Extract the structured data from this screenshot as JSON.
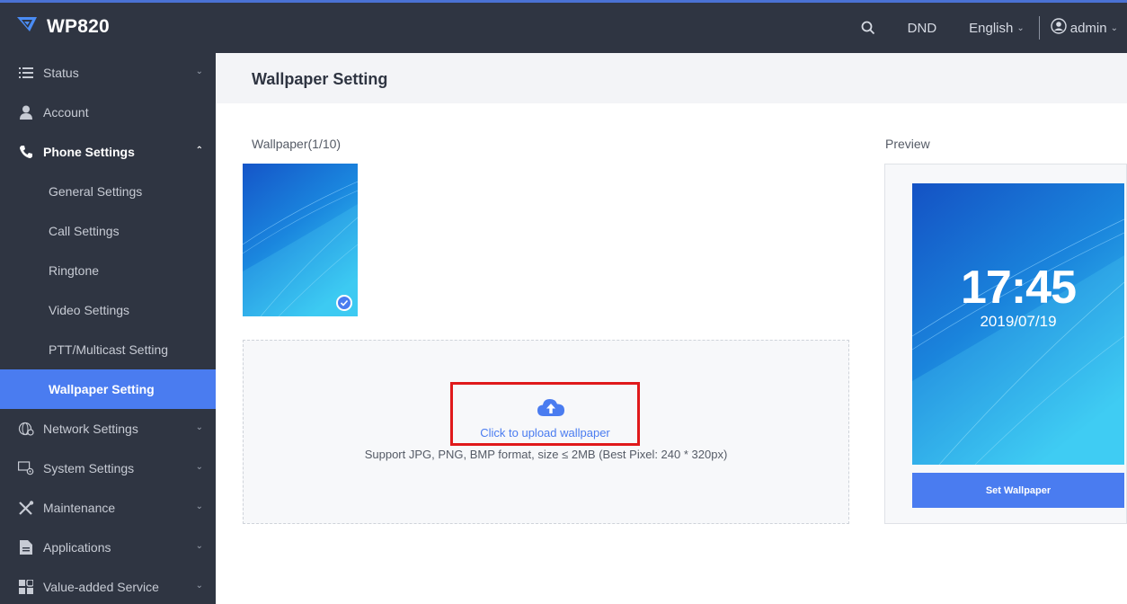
{
  "app": {
    "name": "WP820"
  },
  "topbar": {
    "dnd": "DND",
    "language": "English",
    "user": "admin"
  },
  "sidebar": {
    "items": [
      {
        "label": "Status",
        "icon": "list-icon"
      },
      {
        "label": "Account",
        "icon": "user-icon"
      },
      {
        "label": "Phone Settings",
        "icon": "phone-icon"
      },
      {
        "label": "General Settings"
      },
      {
        "label": "Call Settings"
      },
      {
        "label": "Ringtone"
      },
      {
        "label": "Video Settings"
      },
      {
        "label": "PTT/Multicast Setting"
      },
      {
        "label": "Wallpaper Setting"
      },
      {
        "label": "Network Settings",
        "icon": "network-globe-icon"
      },
      {
        "label": "System Settings",
        "icon": "system-gear-icon"
      },
      {
        "label": "Maintenance",
        "icon": "tools-icon"
      },
      {
        "label": "Applications",
        "icon": "document-icon"
      },
      {
        "label": "Value-added Service",
        "icon": "grid-icon"
      }
    ]
  },
  "page": {
    "title": "Wallpaper Setting",
    "wallpaper_label": "Wallpaper(1/10)",
    "preview_label": "Preview",
    "upload_link": "Click to upload wallpaper",
    "upload_hint": "Support JPG, PNG, BMP format, size ≤ 2MB (Best Pixel: 240 * 320px)",
    "preview_time": "17:45",
    "preview_date": "2019/07/19",
    "set_button": "Set Wallpaper"
  },
  "colors": {
    "topbar": "#2f3542",
    "sidebar": "#2f3542",
    "accent": "#4a7cf0",
    "highlight": "#e0191b"
  }
}
